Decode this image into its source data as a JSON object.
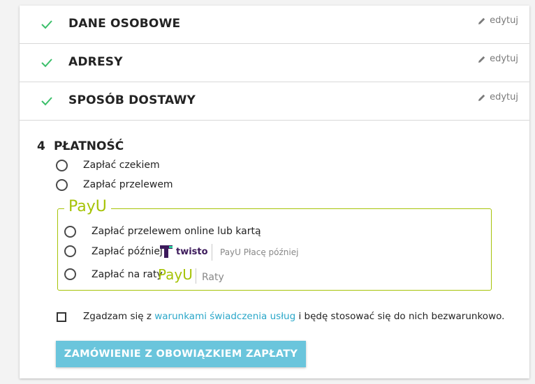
{
  "steps": [
    {
      "title": "DANE OSOBOWE",
      "edit_label": "edytuj"
    },
    {
      "title": "ADRESY",
      "edit_label": "edytuj"
    },
    {
      "title": "SPOSÓB DOSTAWY",
      "edit_label": "edytuj"
    }
  ],
  "payment": {
    "number": "4",
    "title": "PŁATNOŚĆ",
    "options": [
      {
        "label": "Zapłać czekiem"
      },
      {
        "label": "Zapłać przelewem"
      }
    ],
    "payu": {
      "logo_text": "PayU",
      "options": [
        {
          "label": "Zapłać przelewem online lub kartą"
        },
        {
          "label": "Zapłać później",
          "brand": "twisto",
          "suffix": "PayU Płacę później"
        },
        {
          "label": "Zapłać na raty",
          "brand": "PayU",
          "suffix": "Raty"
        }
      ]
    }
  },
  "terms": {
    "prefix": "Zgadzam się z ",
    "link": "warunkami świadczenia usług",
    "suffix": " i będę stosować się do nich bezwarunkowo."
  },
  "order_button": "ZAMÓWIENIE Z OBOWIĄZKIEM ZAPŁATY",
  "colors": {
    "check": "#3bbf6a",
    "payu_green": "#a6c307",
    "link": "#2aa7c9",
    "button": "#6ac5dc",
    "twisto": "#3c1a5b"
  }
}
